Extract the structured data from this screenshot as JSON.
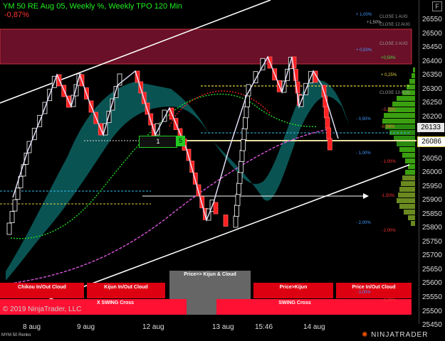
{
  "header": {
    "title": "YM 50 RE Aug 05, Weekly %, Weekly TPO 120 Min",
    "change": "-0,87%",
    "float_button": "F"
  },
  "price_axis": {
    "ticks": [
      "26550",
      "26500",
      "26450",
      "26400",
      "26350",
      "26300",
      "26250",
      "26200",
      "26150",
      "26100",
      "26050",
      "26000",
      "25950",
      "25900",
      "25850",
      "25800",
      "25750",
      "25700",
      "25650",
      "25600",
      "25550",
      "25500",
      "25450"
    ],
    "current_price": "26133",
    "marker_price": "26086"
  },
  "time_axis": {
    "ticks": [
      "8 aug",
      "9 aug",
      "12 aug",
      "13 aug",
      "15:46",
      "14 aug"
    ]
  },
  "levels": {
    "pct_blue": [
      "+ 1,00%",
      "+ 0,50%",
      "- 0,50%",
      "- 1,00%",
      "- 2,00%",
      "- 3,00%"
    ],
    "pct_colored": [
      "+0,50%",
      "+ 0,25%",
      "- 0,25%",
      "-0,56%",
      "- 1,00%",
      "-1,50%",
      "- 2,00%",
      "- 3,00%"
    ],
    "closes": [
      "CLOSE 1 AUG",
      "CLOSE 12 AUG",
      "CLOSE 2 AUG",
      "CLOSE 13 AUG"
    ],
    "close_overlay": "+1,50%"
  },
  "bottom_panels": {
    "chikou": "Chikou In/Out Cloud",
    "kijun_cloud": "Kijun In/Out Cloud",
    "price_kijun_cloud": "Price>> Kijun & Cloud",
    "price_kijun": "Price>Kijun",
    "price_cloud": "Price In/Out Cloud",
    "x_swing": "X SWING Cross",
    "swing": "SWING Cross"
  },
  "marker": {
    "label": "1",
    "badge": "5"
  },
  "copyright": "© 2019 NinjaTrader, LLC",
  "footer": {
    "instrument": "MYM 50 Renko",
    "brand": "NINJATRADER"
  },
  "colors": {
    "bull": "#ffffff",
    "bear": "#ff2020",
    "cloud": "#0a5a5a",
    "profile": "#3aa010",
    "zone": "#7a1530",
    "accent": "#22cc22"
  }
}
